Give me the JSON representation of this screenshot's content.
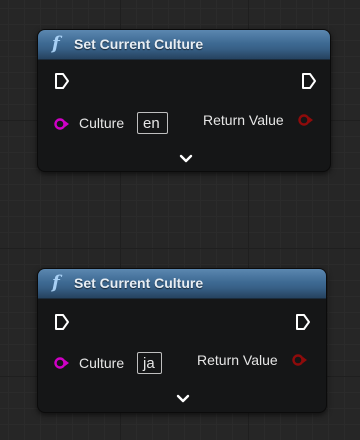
{
  "nodes": [
    {
      "title": "Set Current Culture",
      "func_icon": "f",
      "input_label": "Culture",
      "input_value": "en",
      "output_label": "Return Value",
      "icons": [
        "function-icon",
        "exec-in-pin-icon",
        "exec-out-pin-icon",
        "string-pin-icon",
        "bool-pin-icon",
        "chevron-down-icon"
      ]
    },
    {
      "title": "Set Current Culture",
      "func_icon": "f",
      "input_label": "Culture",
      "input_value": "ja",
      "output_label": "Return Value",
      "icons": [
        "function-icon",
        "exec-in-pin-icon",
        "exec-out-pin-icon",
        "string-pin-icon",
        "bool-pin-icon",
        "chevron-down-icon"
      ]
    }
  ],
  "colors": {
    "header_blue": "#3e6a93",
    "string_pin": "#d000c6",
    "bool_pin": "#8e0b0b",
    "exec_pin": "#ffffff",
    "node_body": "#151617",
    "grid_background": "#262626"
  }
}
